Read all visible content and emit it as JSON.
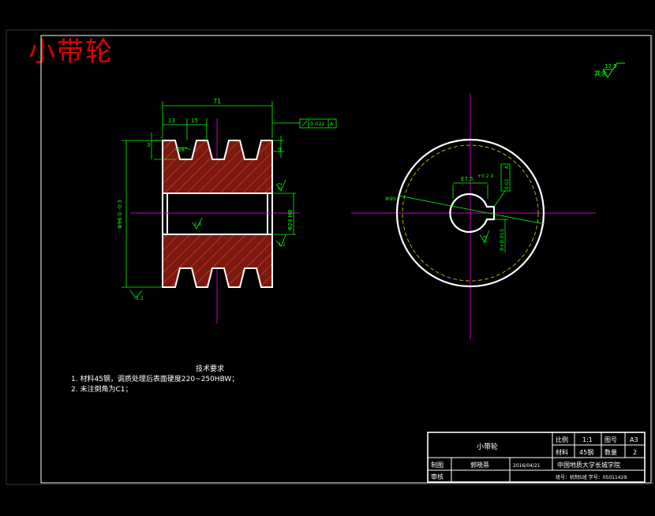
{
  "stamp_title": "小带轮",
  "roughness": {
    "general": "12.5",
    "prefix": "其余"
  },
  "dims": {
    "overall_width": "71",
    "first_groove": "13",
    "groove_pitch": "15",
    "groove_depth_top": "3",
    "groove_small": "9",
    "groove_angle": "38°",
    "runout": "0.022",
    "runout_datum": "A",
    "outer_dia": "Φ96 0 -0.3",
    "bore_dia": "Φ24 H8",
    "rough_bore": "1.6",
    "rough_side1": "3.2",
    "rough_side2": "3.2",
    "rough_groove": "3.2",
    "rough_bottom": "3.2",
    "keyway_width": "E7.5",
    "keyway_tol": "+0.2 0",
    "keyway_sym": "0.02",
    "keyway_sym_datum": "A",
    "keyway_depth": "8+0.015",
    "view_dia": "Φ90",
    "bore_rough_right": "6.3"
  },
  "tech_req": {
    "title": "技术要求",
    "items": [
      "1. 材料45钢，调质处理后表面硬度220~250HBW；",
      "2. 未注倒角为C1；"
    ]
  },
  "title_block": {
    "part_name": "小带轮",
    "scale_label": "比例",
    "scale_value": "1:1",
    "sheet_label": "图号",
    "sheet_value": "A3",
    "material_label": "材料",
    "material_value": "45钢",
    "qty_label": "数量",
    "qty_value": "2",
    "drawn_label": "制图",
    "drawn_name": "郭晓蒂",
    "drawn_date": "2016/04/21",
    "checked_label": "审核",
    "school": "中国地质大学长城学院",
    "class_info": "班号：机制5班  学号：05011429"
  },
  "colors": {
    "outline": "#ffffff",
    "center_line": "#c000c0",
    "dimension": "#00ff00",
    "hatch": "#ff2020",
    "cut_fill": "#7a1a10",
    "hidden": "#d8d800",
    "stamp": "#e00000"
  }
}
